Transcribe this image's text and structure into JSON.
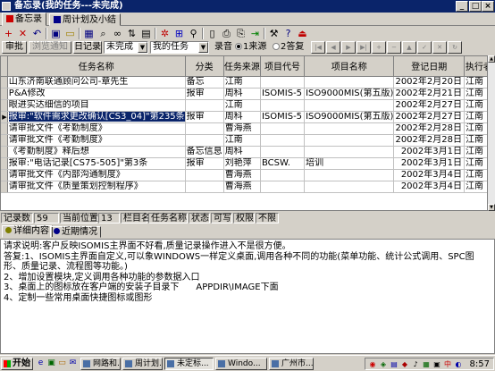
{
  "window": {
    "title": "备忘录(我的任务---未完成)"
  },
  "tabs": [
    {
      "label": "备忘录",
      "active": true
    },
    {
      "label": "周计划及小结",
      "active": false
    }
  ],
  "toolbar": [
    {
      "name": "add-icon",
      "glyph": "+",
      "color": "#c00000"
    },
    {
      "name": "delete-icon",
      "glyph": "✕",
      "color": "#c00000"
    },
    {
      "name": "undo-icon",
      "glyph": "↶",
      "color": "#000080"
    },
    {
      "name": "save-icon",
      "glyph": "▣",
      "color": "#000080"
    },
    {
      "name": "folder-icon",
      "glyph": "▭",
      "color": "#a08000"
    },
    {
      "name": "table-icon",
      "glyph": "▦",
      "color": "#000080"
    },
    {
      "name": "find-icon",
      "glyph": "⌕",
      "color": "#000000"
    },
    {
      "name": "binoculars-icon",
      "glyph": "∞",
      "color": "#000000"
    },
    {
      "name": "sort-icon",
      "glyph": "⇅",
      "color": "#000000"
    },
    {
      "name": "filter-icon",
      "glyph": "▤",
      "color": "#000000"
    },
    {
      "name": "settings-icon",
      "glyph": "✲",
      "color": "#c00000"
    },
    {
      "name": "windows-icon",
      "glyph": "⊞",
      "color": "#0000c0"
    },
    {
      "name": "link-icon",
      "glyph": "⚲",
      "color": "#000000"
    },
    {
      "name": "document-icon",
      "glyph": "▯",
      "color": "#000000"
    },
    {
      "name": "print-icon",
      "glyph": "⎙",
      "color": "#000000"
    },
    {
      "name": "print-preview-icon",
      "glyph": "⎘",
      "color": "#000000"
    },
    {
      "name": "export-icon",
      "glyph": "⇥",
      "color": "#008000"
    },
    {
      "name": "tools-icon",
      "glyph": "⚒",
      "color": "#000000"
    },
    {
      "name": "help-icon",
      "glyph": "?",
      "color": "#000080"
    },
    {
      "name": "exit-icon",
      "glyph": "⏏",
      "color": "#c00000"
    }
  ],
  "filterbar": {
    "review_btn": "审批",
    "review_notice_btn": "浏览通知",
    "journal_btn": "日记录",
    "status_value": "未完成",
    "scope_value": "我的任务",
    "record_label": "录音",
    "radio1": "1来源",
    "radio2": "2答复"
  },
  "table": {
    "columns": [
      "任务名称",
      "分类",
      "任务来源",
      "项目代号",
      "项目名称",
      "登记日期",
      "执行者"
    ],
    "rows": [
      {
        "name": "山东济南联通顾问公司-章先生",
        "category": "备忘",
        "source": "江南",
        "code": "",
        "project": "",
        "date": "2002年2月20日",
        "executor": "江南",
        "selected": false
      },
      {
        "name": "P&A修改",
        "category": "报审",
        "source": "周科",
        "code": "ISOMIS-5",
        "project": "ISO9000MIS(第五版)",
        "date": "2002年2月21日",
        "executor": "江南",
        "selected": false
      },
      {
        "name": "眼进实达细信的项目",
        "category": "",
        "source": "江南",
        "code": "",
        "project": "",
        "date": "2002年2月27日",
        "executor": "江南",
        "selected": false
      },
      {
        "name": "报审:\"软件需求更改确认[CS3_04]\"第235条",
        "category": "报审",
        "source": "周科",
        "code": "ISOMIS-5",
        "project": "ISO9000MIS(第五版)",
        "date": "2002年2月27日",
        "executor": "江南",
        "selected": true
      },
      {
        "name": "请审批文件《考勤制度》",
        "category": "",
        "source": "曹海燕",
        "code": "",
        "project": "",
        "date": "2002年2月28日",
        "executor": "江南",
        "selected": false
      },
      {
        "name": "请审批文件《考勤制度》",
        "category": "",
        "source": "江南",
        "code": "",
        "project": "",
        "date": "2002年2月28日",
        "executor": "江南",
        "selected": false
      },
      {
        "name": "《考勤制度》释后想",
        "category": "备忘信息",
        "source": "周科",
        "code": "",
        "project": "",
        "date": "2002年3月1日",
        "executor": "江南",
        "selected": false
      },
      {
        "name": "报审:\"电话记录[CS75-505]\"第3条",
        "category": "报审",
        "source": "刘艳萍",
        "code": "BCSW.",
        "project": "培训",
        "date": "2002年3月1日",
        "executor": "江南",
        "selected": false
      },
      {
        "name": "请审批文件《内部沟通制度》",
        "category": "",
        "source": "曹海燕",
        "code": "",
        "project": "",
        "date": "2002年3月4日",
        "executor": "江南",
        "selected": false
      },
      {
        "name": "请审批文件《质量策划控制程序》",
        "category": "",
        "source": "曹海燕",
        "code": "",
        "project": "",
        "date": "2002年3月4日",
        "executor": "江南",
        "selected": false
      }
    ]
  },
  "statusbar": {
    "count_label": "记录数",
    "count_value": "59",
    "pos_label": "当前位置",
    "pos_value": "13",
    "col_label": "栏目名",
    "col_value": "任务名称",
    "state_label": "状态",
    "state_value": "可写",
    "perm_label": "权限",
    "perm_value": "不限"
  },
  "detail_tabs": [
    {
      "label": "详细内容",
      "active": true
    },
    {
      "label": "近期情况",
      "active": false
    }
  ],
  "memo": {
    "line1": "请求说明:客户反映ISOMIS主界面不好看,质量记录操作进入不是很方便。",
    "line2": "答复:1、ISOMIS主界面自定义,可以象WINDOWS一样定义桌面,调用各种不同的功能(菜单功能、统计公式调用、SPC图形、质量记录、流程图等功能。)",
    "line3": "2、增加设置模块,定义调用各种功能的参数据入口",
    "line4": "3、桌面上的图标放在客户端的安装子目录下      APPDIR\\IMAGE下面",
    "line5": "4、定制一些常用桌面快捷图标或图形"
  },
  "taskbar": {
    "start_label": "开始",
    "tasks": [
      {
        "label": "网路和...",
        "active": false
      },
      {
        "label": "周计划...",
        "active": false
      },
      {
        "label": "未定标...",
        "active": true
      },
      {
        "label": "Windo...",
        "active": false
      },
      {
        "label": "广州市...",
        "active": false
      }
    ],
    "clock": "8:57"
  }
}
